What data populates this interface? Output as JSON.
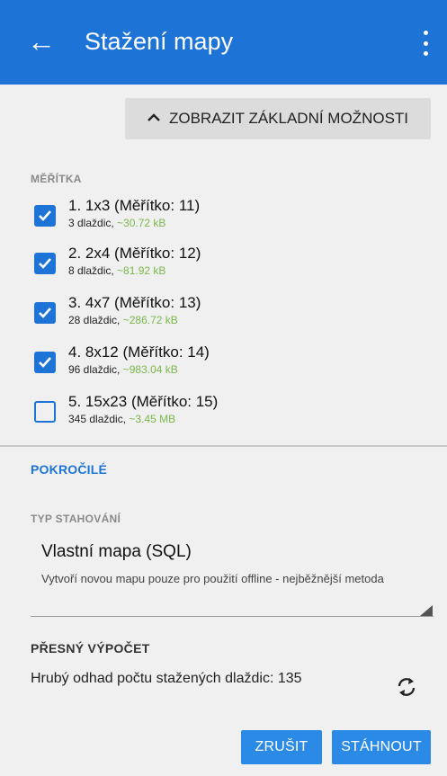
{
  "appbar": {
    "back_icon": "arrow-left-icon",
    "title": "Stažení mapy",
    "menu_icon": "more-vert-icon",
    "background": "#1e74d6"
  },
  "basic_options_button": "ZOBRAZIT ZÁKLADNÍ MOŽNOSTI",
  "scales": {
    "label": "MĚŘÍTKA",
    "items": [
      {
        "name": "1. 1x3 (Měřítko: 11)",
        "tiles": "3 dlaždic,",
        "size": "~30.72 kB",
        "checked": true
      },
      {
        "name": "2. 2x4 (Měřítko: 12)",
        "tiles": "8 dlaždic,",
        "size": "~81.92 kB",
        "checked": true
      },
      {
        "name": "3. 4x7 (Měřítko: 13)",
        "tiles": "28 dlaždic,",
        "size": "~286.72 kB",
        "checked": true
      },
      {
        "name": "4. 8x12 (Měřítko: 14)",
        "tiles": "96 dlaždic,",
        "size": "~983.04 kB",
        "checked": true
      },
      {
        "name": "5. 15x23 (Měřítko: 15)",
        "tiles": "345 dlaždic,",
        "size": "~3.45 MB",
        "checked": false
      }
    ]
  },
  "advanced": {
    "title": "POKROČILÉ",
    "download_type_label": "TYP STAHOVÁNÍ",
    "download_type_value": "Vlastní mapa (SQL)",
    "download_type_desc": "Vytvoří novou mapu pouze pro použití offline - nejběžnější metoda",
    "precise_label": "PŘESNÝ VÝPOČET",
    "estimate_text": "Hrubý odhad počtu stažených dlaždic: 135",
    "refresh_icon": "refresh-icon"
  },
  "actions": {
    "cancel": "ZRUŠIT",
    "download": "STÁHNOUT"
  },
  "colors": {
    "accent": "#1e74d6",
    "size_text": "#7bb84a"
  }
}
